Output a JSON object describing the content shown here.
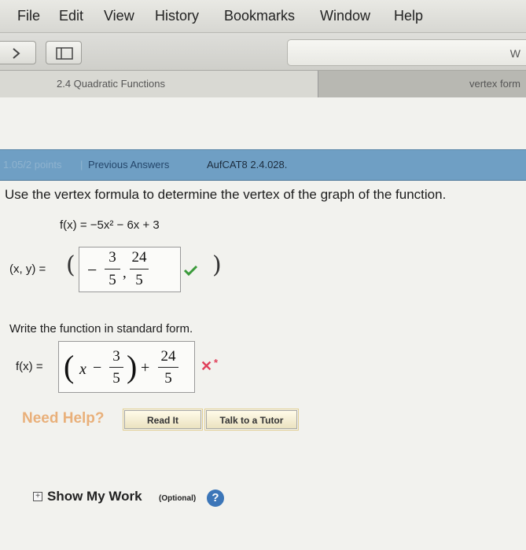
{
  "menu": {
    "items": [
      "File",
      "Edit",
      "View",
      "History",
      "Bookmarks",
      "Window",
      "Help"
    ]
  },
  "toolbar": {
    "forward_icon": "chevron-right-icon",
    "sidebar_icon": "sidebar-icon",
    "url_text": "W"
  },
  "tabs": [
    {
      "label": "2.4 Quadratic Functions"
    },
    {
      "label": "vertex form"
    }
  ],
  "question": {
    "points": "1.05/2 points",
    "separator": "|",
    "previous_answers": "Previous Answers",
    "code": "AufCAT8 2.4.028.",
    "prompt": "Use the vertex formula to determine the vertex of the graph of the function.",
    "function": "f(x) = −5x² − 6x + 3",
    "vertex_label": "(x, y) =",
    "vertex_x_sign": "−",
    "vertex_x_num": "3",
    "vertex_x_den": "5",
    "comma": ",",
    "vertex_y_num": "24",
    "vertex_y_den": "5",
    "vertex_status_icon": "checkmark-icon",
    "standard_prompt": "Write the function in standard form.",
    "standard_label": "f(x) =",
    "std_x": "x",
    "std_minus": "−",
    "std_h_num": "3",
    "std_h_den": "5",
    "std_plus": "+",
    "std_k_num": "24",
    "std_k_den": "5",
    "standard_status_icon": "cross-icon",
    "standard_status_mark": "✕",
    "standard_status_star": "*"
  },
  "help": {
    "need_help": "Need Help?",
    "read_it": "Read It",
    "talk_to_tutor": "Talk to a Tutor"
  },
  "show_work": {
    "expand": "+",
    "label": "Show My Work",
    "optional": "(Optional)",
    "help_icon": "?"
  },
  "colors": {
    "header_bar": "#6f9fc4",
    "correct": "#3a9a3a",
    "incorrect": "#e0405a",
    "need_help": "#e9b07a"
  }
}
